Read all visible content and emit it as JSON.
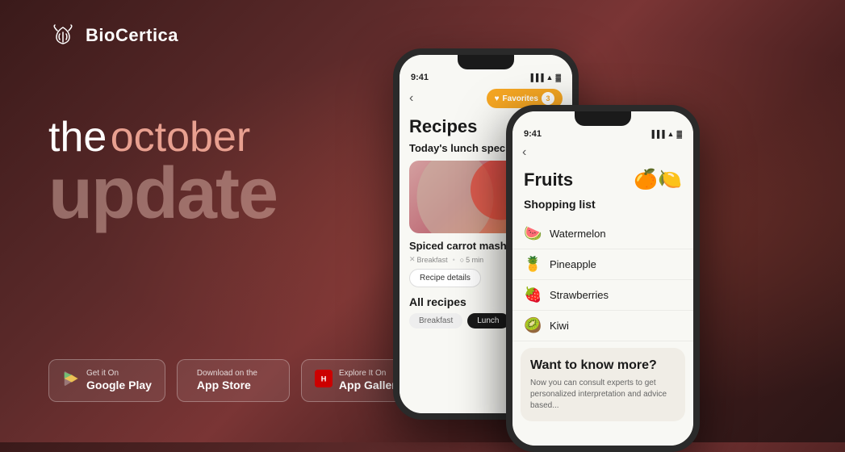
{
  "brand": {
    "name": "BioCertica",
    "logo_alt": "BioCertica logo"
  },
  "hero": {
    "line1_the": "the",
    "line1_october": "october",
    "line2": "update"
  },
  "store_buttons": [
    {
      "id": "google-play",
      "small_text": "Get it On",
      "big_text": "Google Play",
      "icon": "▶"
    },
    {
      "id": "app-store",
      "small_text": "Download on the",
      "big_text": "App Store",
      "icon": ""
    },
    {
      "id": "app-gallery",
      "small_text": "Explore It On",
      "big_text": "App Gallery",
      "icon": "🌐"
    }
  ],
  "phone1": {
    "status_time": "9:41",
    "nav_back": "‹",
    "favorites_label": "Favorites",
    "favorites_count": "3",
    "recipes_title": "Recipes",
    "today_lunch": "Today's lunch speci...",
    "recipe_name": "Spiced carrot mash",
    "recipe_tag_breakfast": "Breakfast",
    "recipe_tag_time": "5 min",
    "recipe_details_btn": "Recipe details",
    "all_recipes_title": "All recipes",
    "filter_breakfast": "Breakfast",
    "filter_lunch": "Lunch"
  },
  "phone2": {
    "status_time": "9:41",
    "nav_back": "‹",
    "fruits_title": "Fruits",
    "fruits_emoji": "🍊🍋",
    "shopping_list_title": "Shopping list",
    "fruits": [
      {
        "emoji": "🍉",
        "name": "Watermelon"
      },
      {
        "emoji": "🍍",
        "name": "Pineapple"
      },
      {
        "emoji": "🍓",
        "name": "Strawberries"
      },
      {
        "emoji": "🥝",
        "name": "Kiwi"
      }
    ],
    "want_title": "Want to know more?",
    "want_desc": "Now you can consult experts to get personalized interpretation and advice based..."
  },
  "colors": {
    "background_start": "#3a1a1a",
    "background_mid": "#7a3535",
    "accent_orange": "#f5a623",
    "text_white": "#ffffff",
    "text_muted": "rgba(255,255,255,0.7)"
  }
}
